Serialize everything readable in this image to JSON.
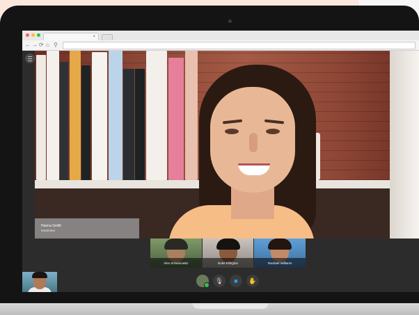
{
  "browser": {
    "tab_close": "×",
    "nav": {
      "back": "←",
      "forward": "→",
      "reload": "⟳",
      "home": "⌂",
      "search": "⚲"
    },
    "traffic_lights": [
      "#fe5f57",
      "#febc2e",
      "#28c840"
    ]
  },
  "main_speaker": {
    "name": "Hanna Smith",
    "role": "Moderator"
  },
  "participants": [
    {
      "name": "Alex Scheimowitz"
    },
    {
      "name": "Duke Ellington"
    },
    {
      "name": "Rachael Williams"
    }
  ],
  "controls": {
    "icons": [
      "avatar-icon",
      "microphone-off-icon",
      "video-camera-icon",
      "hand-raise-icon"
    ],
    "mic_glyph": "🎙",
    "video_glyph": "■",
    "hand_glyph": "✋"
  },
  "colors": {
    "status_online": "#37c14a",
    "video_accent": "#1fa3e8"
  }
}
